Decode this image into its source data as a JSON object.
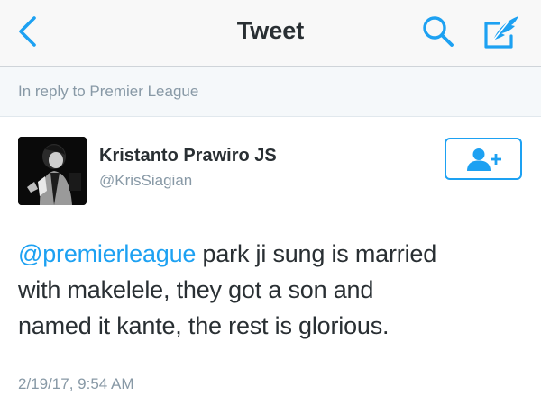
{
  "nav": {
    "title": "Tweet",
    "back_icon": "chevron-left-icon",
    "search_icon": "search-icon",
    "compose_icon": "compose-tweet-icon",
    "accent_color": "#1da1f2"
  },
  "reply_context": {
    "text": "In reply to Premier League"
  },
  "author": {
    "name": "Kristanto Prawiro JS",
    "handle": "@KrisSiagian",
    "avatar": "avatar-image",
    "follow_icon": "follow-user-icon"
  },
  "tweet": {
    "mention": "@premierleague",
    "line1_rest": " park ji sung is married",
    "line2": "with makelele, they got a son and",
    "line3": "named it kante, the rest is glorious.",
    "timestamp": "2/19/17, 9:54 AM"
  }
}
